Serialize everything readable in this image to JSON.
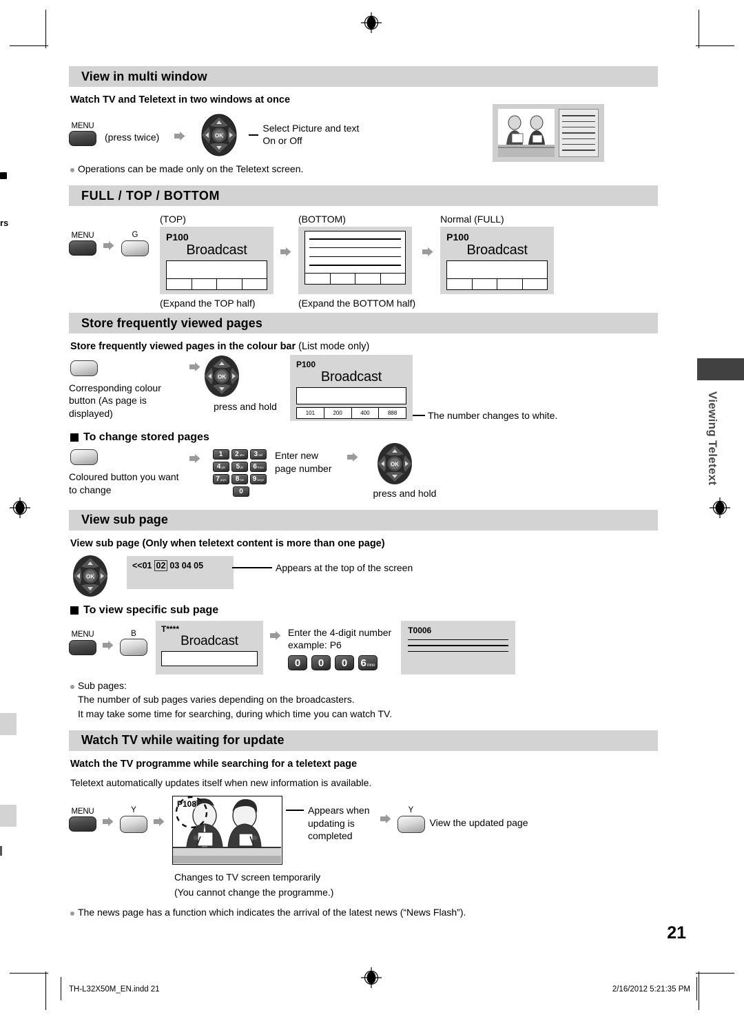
{
  "sections": [
    {
      "id": "multi-window",
      "title": "View in multi window",
      "sub_head": "Watch TV and Teletext in two windows at once",
      "menu_label": "MENU",
      "press_twice": "(press twice)",
      "dpad_text_line1": "Select Picture and text",
      "dpad_text_line2": "On or Off",
      "note": "Operations can be made only on the Teletext screen."
    },
    {
      "id": "full-top-bottom",
      "title": "FULL / TOP / BOTTOM",
      "menu_label": "MENU",
      "green_key": "G",
      "screens": [
        {
          "cap_top": "(TOP)",
          "page": "P100",
          "broadcast": "Broadcast",
          "cap_bottom": "(Expand the TOP half)"
        },
        {
          "cap_top": "(BOTTOM)",
          "page": "",
          "broadcast": "",
          "cap_bottom": "(Expand the BOTTOM half)"
        },
        {
          "cap_top": "Normal (FULL)",
          "page": "P100",
          "broadcast": "Broadcast",
          "cap_bottom": ""
        }
      ]
    },
    {
      "id": "store-pages",
      "title": "Store frequently viewed pages",
      "sub_head_bold": "Store frequently viewed pages",
      "sub_head_mid": " in the colour bar ",
      "sub_head_light": "(List mode only)",
      "colour_button_text": "Corresponding colour button (As page is displayed)",
      "press_and_hold": "press and hold",
      "screen": {
        "page": "P100",
        "broadcast": "Broadcast",
        "colour_bar": [
          "101",
          "200",
          "400",
          "888"
        ]
      },
      "callout": "The number changes to white.",
      "change_head": "To change stored pages",
      "change_button_text": "Coloured button you want to change",
      "enter_new_line1": "Enter new",
      "enter_new_line2": "page number",
      "change_press_hold": "press and hold",
      "keypad": [
        {
          "d": "1",
          "s": ""
        },
        {
          "d": "2",
          "s": "abc"
        },
        {
          "d": "3",
          "s": "def"
        },
        {
          "d": "4",
          "s": "ghi"
        },
        {
          "d": "5",
          "s": "jkl"
        },
        {
          "d": "6",
          "s": "mno"
        },
        {
          "d": "7",
          "s": "pqrs"
        },
        {
          "d": "8",
          "s": "tuv"
        },
        {
          "d": "9",
          "s": "wxyz"
        },
        {
          "d": "0",
          "s": ""
        }
      ]
    },
    {
      "id": "view-sub-page",
      "title": "View sub page",
      "sub_head": "View sub page (Only when teletext content is more than one page)",
      "subpage_prefix": "<<01",
      "subpage_selected": "02",
      "subpage_rest": "03 04 05",
      "callout": "Appears at the top of the screen",
      "specific_head": "To view specific sub page",
      "menu_label": "MENU",
      "blue_key": "B",
      "screen": {
        "page": "T****",
        "broadcast": "Broadcast"
      },
      "enter_line1": "Enter the 4-digit number",
      "enter_line2": "example: P6",
      "digits": [
        {
          "d": "0",
          "s": ""
        },
        {
          "d": "0",
          "s": ""
        },
        {
          "d": "0",
          "s": ""
        },
        {
          "d": "6",
          "s": "mno"
        }
      ],
      "result_screen": {
        "page": "T0006"
      },
      "notes_label": "Sub pages:",
      "notes_line1": "The number of sub pages varies depending on the broadcasters.",
      "notes_line2": "It may take some time for searching, during which time you can watch TV."
    },
    {
      "id": "watch-tv-update",
      "title": "Watch TV while waiting for update",
      "sub_head": "Watch the TV programme while searching for a teletext page",
      "body": "Teletext automatically updates itself when new information is available.",
      "menu_label": "MENU",
      "yellow_key_1": "Y",
      "yellow_key_2": "Y",
      "screen_page": "P108",
      "callout_line1": "Appears when",
      "callout_line2": "updating is",
      "callout_line3": "completed",
      "view_updated": "View the updated page",
      "changes_line1": "Changes to TV screen temporarily",
      "changes_line2": "(You cannot change the programme.)",
      "final_note": "The news page has a function which indicates the arrival of the latest news (“News Flash”)."
    }
  ],
  "side_tab": {
    "label": "Viewing Teletext"
  },
  "page_number": "21",
  "footer": {
    "file": "TH-L32X50M_EN.indd   21",
    "timestamp": "2/16/2012   5:21:35 PM"
  },
  "left_margin": {
    "fragment_top": "rs"
  },
  "colors": {
    "section_bar": "#d3d3d3",
    "screen_bg": "#d6d6d6",
    "tab_dark": "#414141",
    "key_dark": "#2a2a2a"
  }
}
